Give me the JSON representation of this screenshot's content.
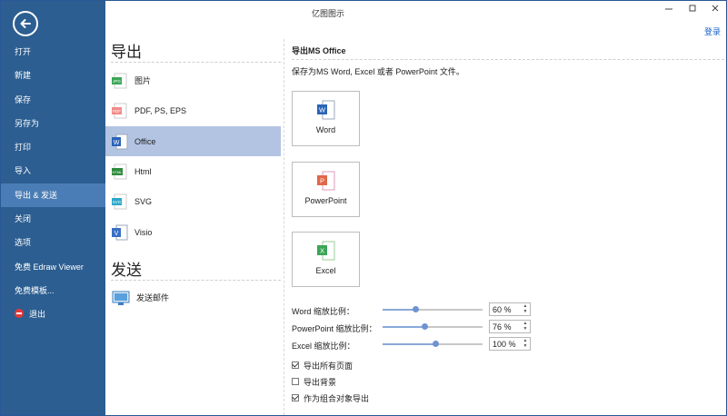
{
  "window": {
    "title": "亿图图示",
    "login": "登录"
  },
  "sidebar": {
    "items": [
      {
        "label": "打开"
      },
      {
        "label": "新建"
      },
      {
        "label": "保存"
      },
      {
        "label": "另存为"
      },
      {
        "label": "打印"
      },
      {
        "label": "导入"
      },
      {
        "label": "导出 & 发送",
        "active": true
      },
      {
        "label": "关闭"
      },
      {
        "label": "选项"
      },
      {
        "label": "免费 Edraw Viewer"
      },
      {
        "label": "免费模板..."
      },
      {
        "label": "退出"
      }
    ]
  },
  "export_section": {
    "heading": "导出",
    "formats": [
      {
        "label": "图片",
        "icon": "jpg-icon",
        "color": "#3aa655",
        "tag": "JPG"
      },
      {
        "label": "PDF, PS, EPS",
        "icon": "pdf-icon",
        "color": "#f28a8a",
        "tag": "PDF"
      },
      {
        "label": "Office",
        "icon": "word-icon",
        "color": "#2b63b8",
        "tag": "W",
        "active": true
      },
      {
        "label": "Html",
        "icon": "html-icon",
        "color": "#2e8b3d",
        "tag": "HTML"
      },
      {
        "label": "SVG",
        "icon": "svg-icon",
        "color": "#2aa7c9",
        "tag": "SVG"
      },
      {
        "label": "Visio",
        "icon": "visio-icon",
        "color": "#3a6fc4",
        "tag": "V"
      }
    ]
  },
  "send_section": {
    "heading": "发送",
    "items": [
      {
        "label": "发送邮件",
        "icon": "email-icon"
      }
    ]
  },
  "panel": {
    "title": "导出MS Office",
    "description": "保存为MS Word, Excel 或者 PowerPoint 文件。",
    "buttons": [
      {
        "label": "Word",
        "icon": "word-icon",
        "color": "#2b63b8",
        "tag": "W"
      },
      {
        "label": "PowerPoint",
        "icon": "powerpoint-icon",
        "color": "#e0674a",
        "tag": "P"
      },
      {
        "label": "Excel",
        "icon": "excel-icon",
        "color": "#3aa655",
        "tag": "X"
      }
    ],
    "scales": [
      {
        "label": "Word 缩放比例：",
        "value": "60 %",
        "level": 0.33
      },
      {
        "label": "PowerPoint 缩放比例：",
        "value": "76 %",
        "level": 0.42
      },
      {
        "label": "Excel 缩放比例：",
        "value": "100 %",
        "level": 0.53
      }
    ],
    "options": [
      {
        "label": "导出所有页面",
        "checked": true
      },
      {
        "label": "导出背景",
        "checked": false
      },
      {
        "label": "作为组合对象导出",
        "checked": true
      }
    ]
  },
  "colors": {
    "sidebar": "#2c5e91",
    "sidebar_active": "#4a7db5",
    "selected_row": "#b3c4e3",
    "link": "#1a62c4"
  }
}
